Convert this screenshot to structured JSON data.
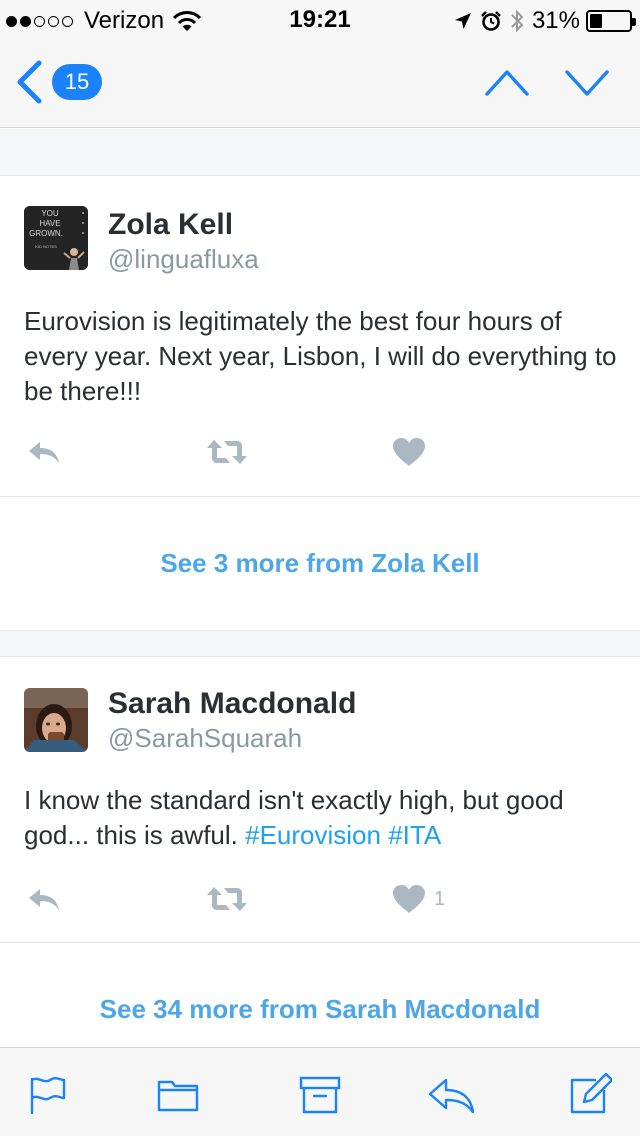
{
  "status_bar": {
    "carrier": "Verizon",
    "time": "19:21",
    "battery": "31%",
    "battery_level": 0.31
  },
  "nav": {
    "back_count": "15"
  },
  "tweets": [
    {
      "name": "Zola Kell",
      "handle": "@linguafluxa",
      "text": "Eurovision is legitimately the best four hours of every year. Next year, Lisbon, I will do everything to be there!!!",
      "avatar_text": [
        "YOU",
        "HAVE",
        "GROWN.",
        "KID NOTES"
      ],
      "likes": "",
      "see_more": "See 3 more from Zola Kell"
    },
    {
      "name": "Sarah Macdonald",
      "handle": "@SarahSquarah",
      "text": "I know the standard isn't exactly high, but good god... this is awful.",
      "hashtags": [
        "#Eurovision",
        "#ITA"
      ],
      "likes": "1",
      "see_more": "See 34 more from Sarah Macdonald"
    }
  ],
  "colors": {
    "accent": "#1a82fb",
    "link": "#4da6e8",
    "hashtag": "#1da1f2",
    "icon_gray": "#aab8c2",
    "handle": "#8899a6"
  }
}
